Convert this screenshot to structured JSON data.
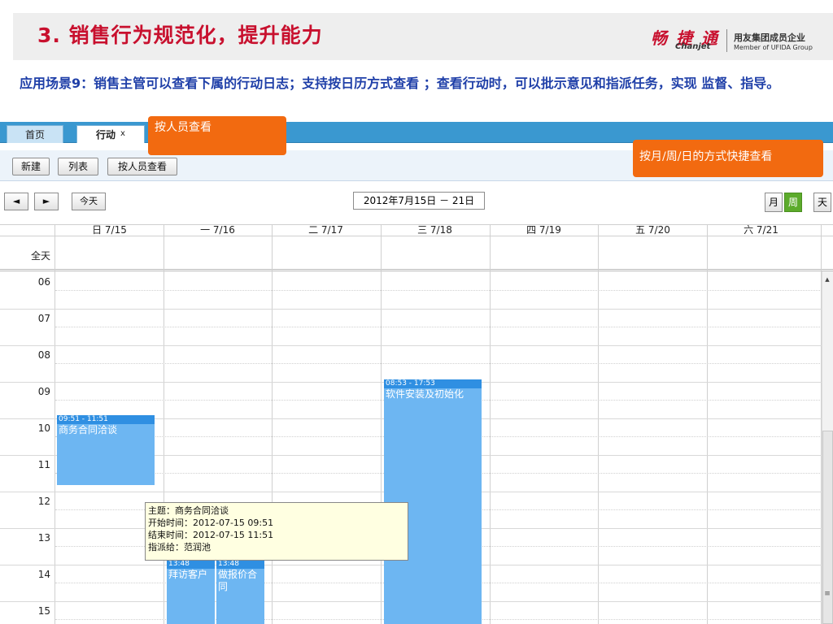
{
  "slide": {
    "title": "3. 销售行为规范化，提升能力",
    "description": "应用场景9：销售主管可以查看下属的行动日志；支持按日历方式查看 ；查看行动时，可以批示意见和指派任务，实现 监督、指导。",
    "logo": {
      "cn": "畅 捷 通",
      "en": "Chanjet",
      "sub1": "用友集团成员企业",
      "sub2": "Member of UFIDA Group"
    }
  },
  "tabs": [
    {
      "label": "首页"
    },
    {
      "label": "行动",
      "close": "x"
    }
  ],
  "toolbar": {
    "new_label": "新建",
    "list_label": "列表",
    "by_person_label": "按人员查看"
  },
  "callouts": {
    "by_person": "按人员查看",
    "quick_view": "按月/周/日的方式快捷查看"
  },
  "nav": {
    "prev": "◄",
    "next": "►",
    "today": "今天",
    "date_range": "2012年7月15日 － 21日",
    "views": [
      "月",
      "周",
      "天"
    ],
    "active_view": "周"
  },
  "calendar": {
    "allday_label": "全天",
    "days": [
      "日 7/15",
      "一 7/16",
      "二 7/17",
      "三 7/18",
      "四 7/19",
      "五 7/20",
      "六 7/21"
    ],
    "hours": [
      "06",
      "07",
      "08",
      "09",
      "10",
      "11",
      "12",
      "13",
      "14",
      "15"
    ],
    "events": [
      {
        "time": "09:51 - 11:51",
        "title": "商务合同洽谈"
      },
      {
        "time": "08:53 - 17:53",
        "title": "软件安装及初始化"
      },
      {
        "time": "13:48",
        "title": "拜访客户"
      },
      {
        "time": "13:48",
        "title": "做报价合同"
      }
    ]
  },
  "tooltip": {
    "lines": [
      "主题：商务合同洽谈",
      "开始时间：2012-07-15 09:51",
      "结束时间：2012-07-15 11:51",
      "指派给：范润池"
    ]
  },
  "colors": {
    "title_red": "#c8102e",
    "desc_blue": "#1f3fa8",
    "tabbar_blue": "#3a98d0",
    "callout_orange": "#f26a10",
    "event_blue": "#6db6f2",
    "event_head_blue": "#2f8fe2",
    "active_view_green": "#5cab2b"
  }
}
